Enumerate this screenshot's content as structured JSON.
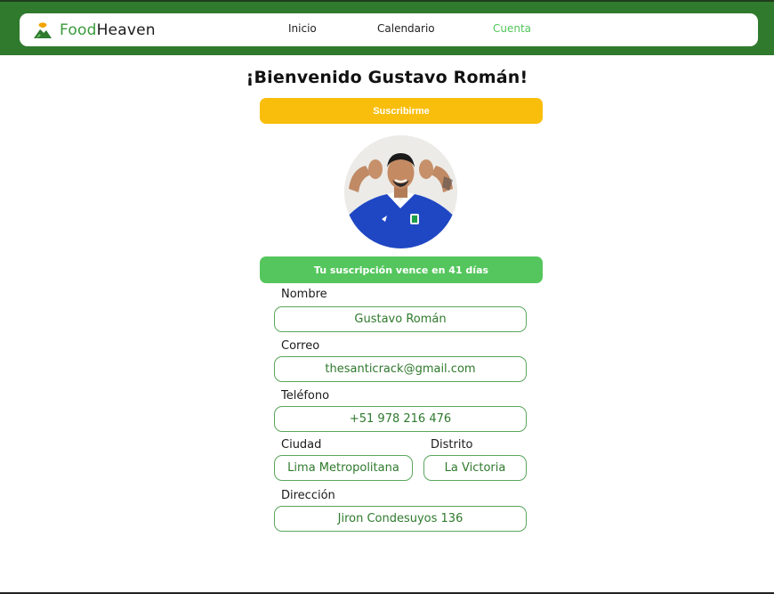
{
  "brand": {
    "name_part1": "Food",
    "name_part2": "Heaven",
    "icon": "chef-hat-logo-icon"
  },
  "nav": {
    "items": [
      {
        "label": "Inicio"
      },
      {
        "label": "Calendario"
      },
      {
        "label": "Cuenta"
      }
    ],
    "active": "Cuenta"
  },
  "colors": {
    "header_green": "#2f7a2d",
    "accent_green": "#55c65d",
    "subscribe_yellow": "#f9be0c"
  },
  "page": {
    "welcome": "¡Bienvenido Gustavo Román!"
  },
  "subscribe_button": {
    "label": "Suscribirme"
  },
  "subscription": {
    "status_text": "Tu suscripción vence en 41 días"
  },
  "profile": {
    "avatar": "user-photo"
  },
  "form": {
    "nombre": {
      "label": "Nombre",
      "value": "Gustavo Román"
    },
    "correo": {
      "label": "Correo",
      "value": "thesanticrack@gmail.com"
    },
    "telefono": {
      "label": "Teléfono",
      "value": "+51 978 216 476"
    },
    "ciudad": {
      "label": "Ciudad",
      "value": "Lima Metropolitana"
    },
    "distrito": {
      "label": "Distrito",
      "value": "La Victoria"
    },
    "direccion": {
      "label": "Dirección",
      "value": "Jiron Condesuyos 136"
    }
  }
}
